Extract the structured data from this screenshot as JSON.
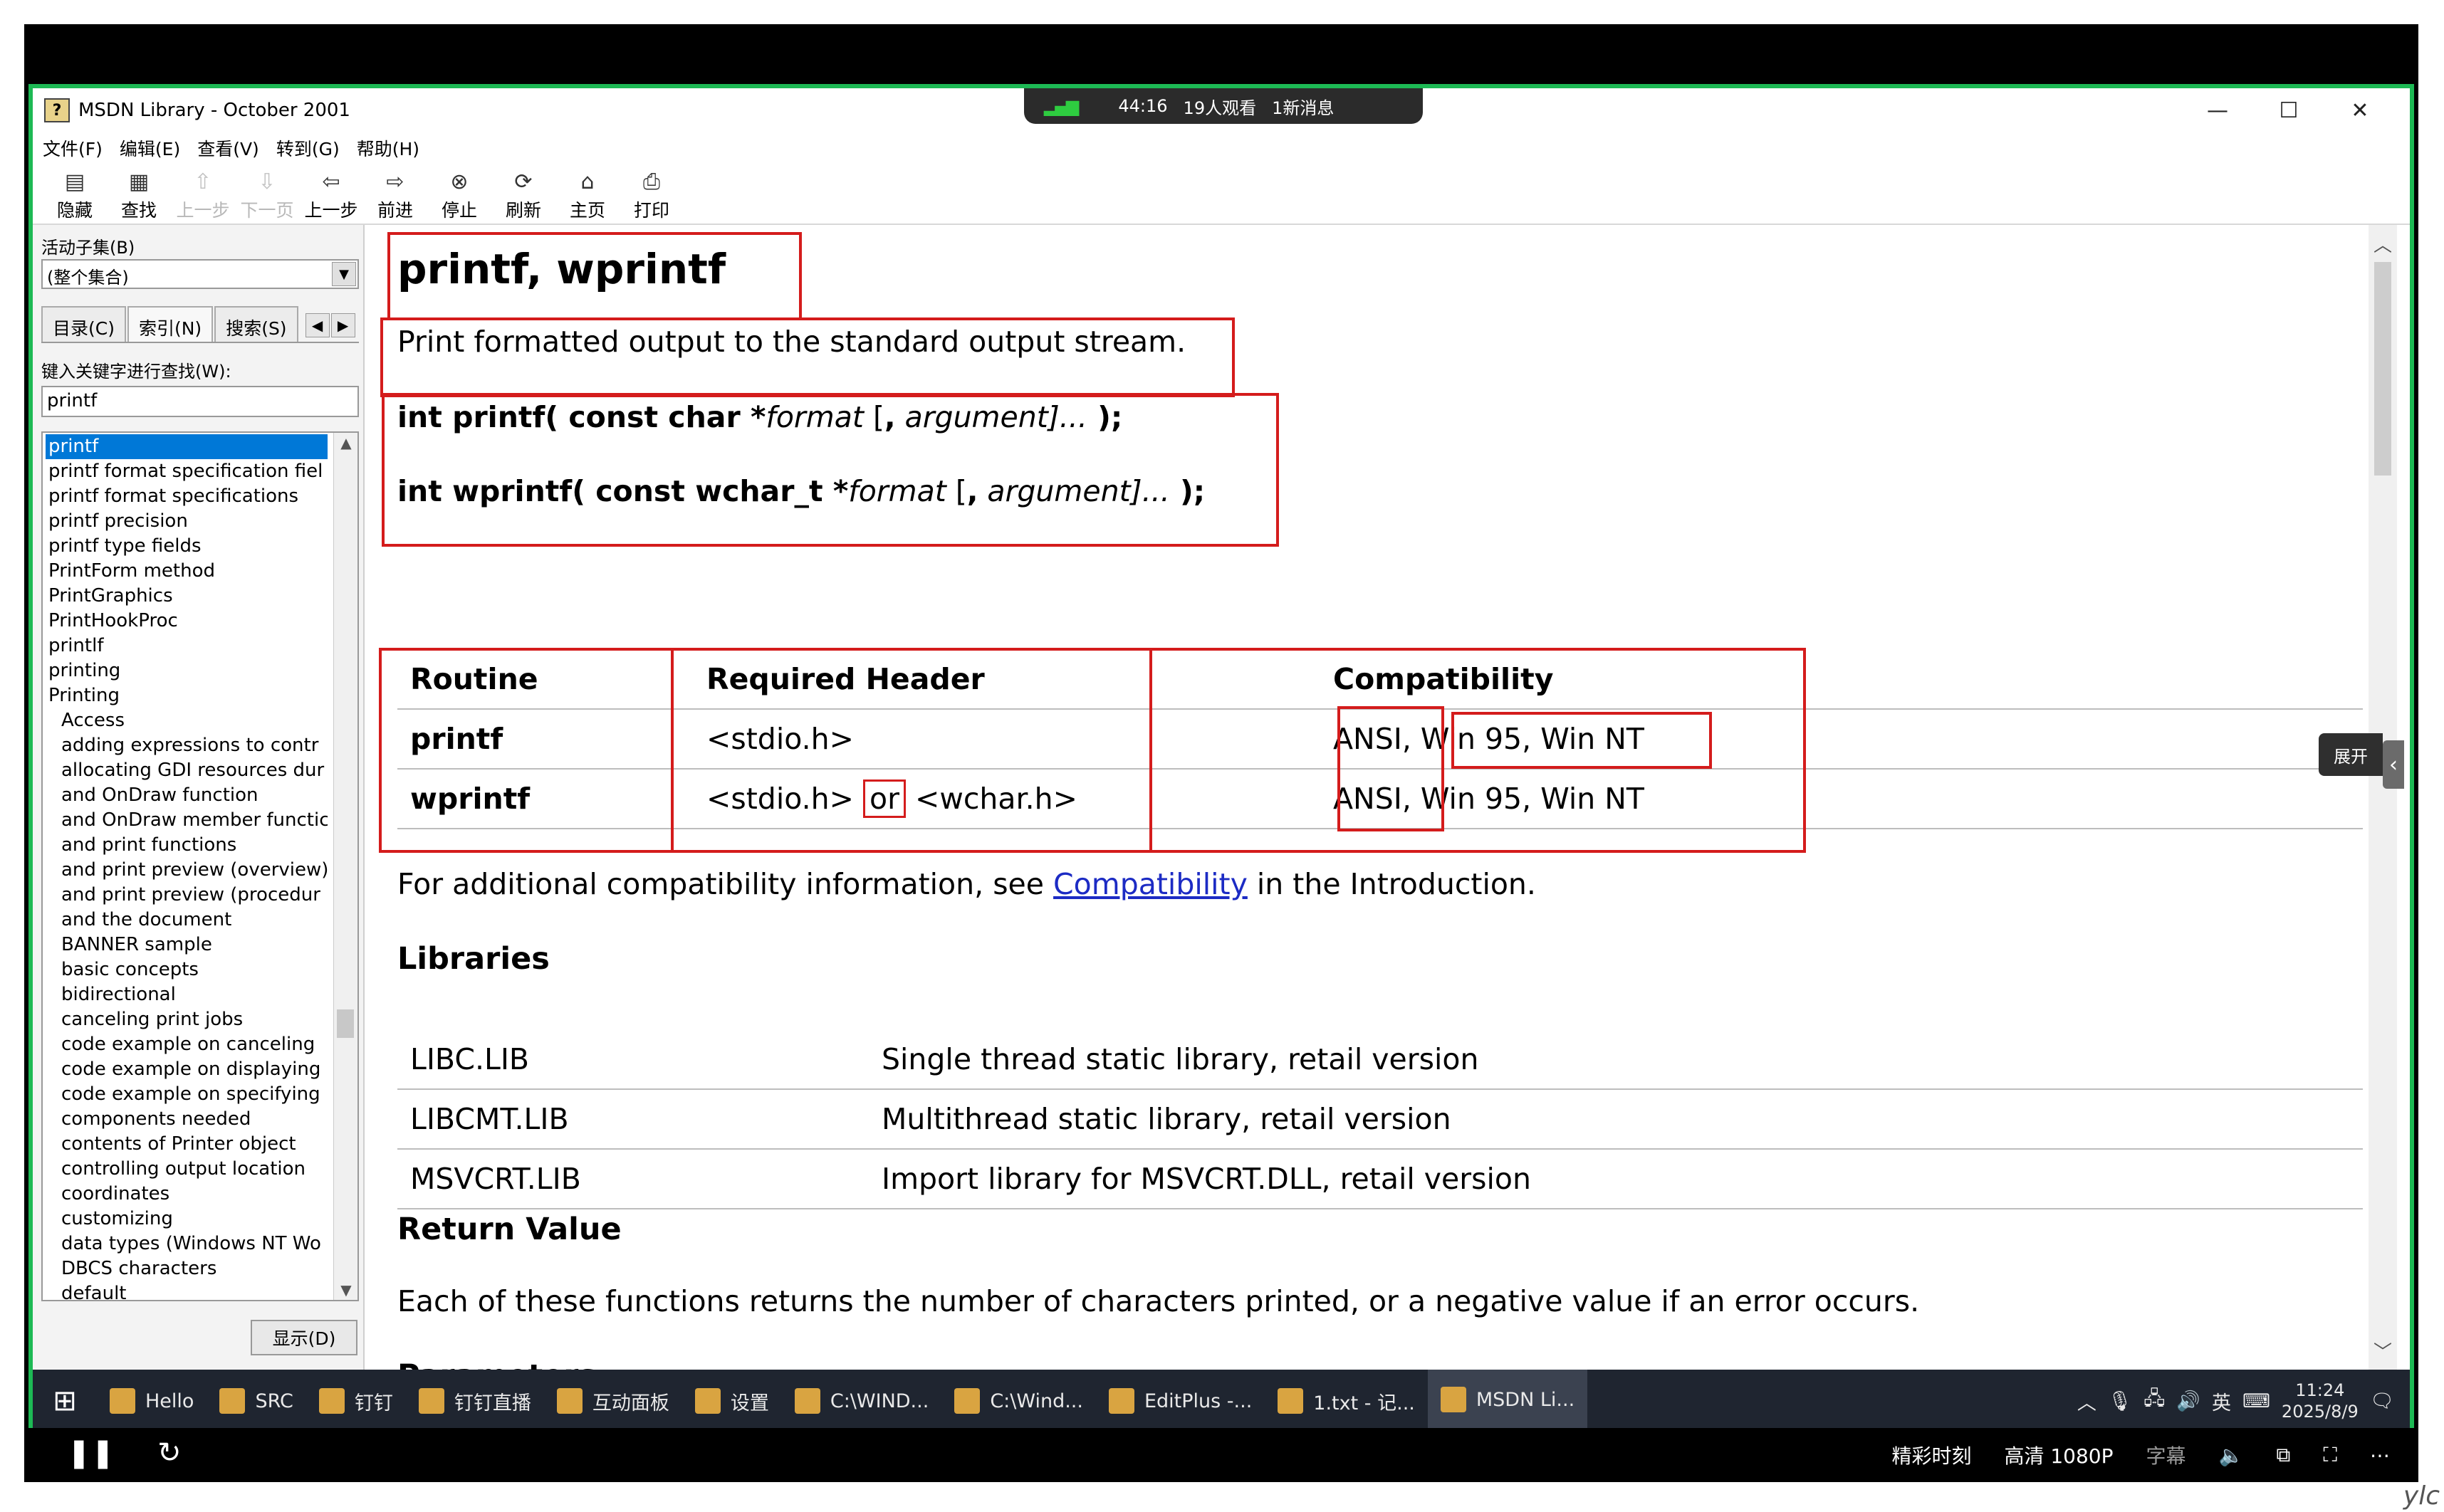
{
  "live": {
    "time": "44:16",
    "viewers": "19人观看",
    "messages": "1新消息"
  },
  "window": {
    "title": "MSDN Library - October 2001"
  },
  "menu": [
    "文件(F)",
    "编辑(E)",
    "查看(V)",
    "转到(G)",
    "帮助(H)"
  ],
  "toolbar": [
    {
      "label": "隐藏",
      "icon": "▤",
      "enabled": true
    },
    {
      "label": "查找",
      "icon": "▦",
      "enabled": true
    },
    {
      "label": "上一步",
      "icon": "⇧",
      "enabled": false
    },
    {
      "label": "下一页",
      "icon": "⇩",
      "enabled": false
    },
    {
      "label": "上一步",
      "icon": "⇦",
      "enabled": true
    },
    {
      "label": "前进",
      "icon": "⇨",
      "enabled": true
    },
    {
      "label": "停止",
      "icon": "⊗",
      "enabled": true
    },
    {
      "label": "刷新",
      "icon": "⟳",
      "enabled": true
    },
    {
      "label": "主页",
      "icon": "⌂",
      "enabled": true
    },
    {
      "label": "打印",
      "icon": "⎙",
      "enabled": true
    }
  ],
  "left": {
    "subset_label": "活动子集(B)",
    "subset_value": "(整个集合)",
    "tabs": [
      "目录(C)",
      "索引(N)",
      "搜索(S)"
    ],
    "keyword_label": "键入关键字进行查找(W):",
    "keyword_value": "printf",
    "index_items": [
      {
        "text": "printf",
        "sel": true
      },
      {
        "text": "printf format specification fiel"
      },
      {
        "text": "printf format specifications"
      },
      {
        "text": "printf precision"
      },
      {
        "text": "printf type fields"
      },
      {
        "text": "PrintForm method"
      },
      {
        "text": "PrintGraphics"
      },
      {
        "text": "PrintHookProc"
      },
      {
        "text": "printlf"
      },
      {
        "text": "printing"
      },
      {
        "text": "Printing"
      },
      {
        "text": "Access",
        "sub": true
      },
      {
        "text": "adding expressions to contr",
        "sub": true
      },
      {
        "text": "allocating GDI resources dur",
        "sub": true
      },
      {
        "text": "and OnDraw function",
        "sub": true
      },
      {
        "text": "and OnDraw member functic",
        "sub": true
      },
      {
        "text": "and print functions",
        "sub": true
      },
      {
        "text": "and print preview (overview)",
        "sub": true
      },
      {
        "text": "and print preview (procedur",
        "sub": true
      },
      {
        "text": "and the document",
        "sub": true
      },
      {
        "text": "BANNER sample",
        "sub": true
      },
      {
        "text": "basic concepts",
        "sub": true
      },
      {
        "text": "bidirectional",
        "sub": true
      },
      {
        "text": "canceling print jobs",
        "sub": true
      },
      {
        "text": "code example on canceling",
        "sub": true
      },
      {
        "text": "code example on displaying",
        "sub": true
      },
      {
        "text": "code example on specifying",
        "sub": true
      },
      {
        "text": "components needed",
        "sub": true
      },
      {
        "text": "contents of Printer object",
        "sub": true
      },
      {
        "text": "controlling output location",
        "sub": true
      },
      {
        "text": "coordinates",
        "sub": true
      },
      {
        "text": "customizing",
        "sub": true
      },
      {
        "text": "data types (Windows NT Wo",
        "sub": true
      },
      {
        "text": "DBCS characters",
        "sub": true
      },
      {
        "text": "default",
        "sub": true
      }
    ],
    "display_button": "显示(D)"
  },
  "doc": {
    "title": "printf, wprintf",
    "summary": "Print formatted output to the standard output stream.",
    "syntax": [
      {
        "lead": "int printf( const char *",
        "arg1": "format",
        "mid": " [",
        "comma": ",",
        "arg2": " argument",
        "tail": "]...",
        "close": " );"
      },
      {
        "lead": "int wprintf( const wchar_t *",
        "arg1": "format",
        "mid": " [",
        "comma": ",",
        "arg2": " argument",
        "tail": "]...",
        "close": " );"
      }
    ],
    "req_table": {
      "headers": [
        "Routine",
        "Required Header",
        "Compatibility"
      ],
      "rows": [
        {
          "routine": "printf",
          "header": "<stdio.h>",
          "header_or": "",
          "header2": "",
          "compat_a": "ANSI",
          "compat_b": ", Win 95, Win NT"
        },
        {
          "routine": "wprintf",
          "header": "<stdio.h>",
          "header_or": "or",
          "header2": "<wchar.h>",
          "compat_a": "ANSI",
          "compat_b": ", Win 95, Win NT"
        }
      ]
    },
    "compat_note": {
      "before": "For additional compatibility information, see ",
      "link": "Compatibility",
      "after": " in the Introduction."
    },
    "libraries_heading": "Libraries",
    "libraries": [
      {
        "lib": "LIBC.LIB",
        "desc": "Single thread static library, retail version"
      },
      {
        "lib": "LIBCMT.LIB",
        "desc": "Multithread static library, retail version"
      },
      {
        "lib": "MSVCRT.LIB",
        "desc": "Import library for MSVCRT.DLL, retail version"
      }
    ],
    "return_heading": "Return Value",
    "return_text": "Each of these functions returns the number of characters printed, or a negative value if an error occurs.",
    "params_heading": "Parameters"
  },
  "expand_label": "展开",
  "taskbar": {
    "items": [
      {
        "label": "Hello"
      },
      {
        "label": "SRC"
      },
      {
        "label": "钉钉"
      },
      {
        "label": "钉钉直播"
      },
      {
        "label": "互动面板"
      },
      {
        "label": "设置"
      },
      {
        "label": "C:\\WIND..."
      },
      {
        "label": "C:\\Wind..."
      },
      {
        "label": "EditPlus -..."
      },
      {
        "label": "1.txt - 记..."
      },
      {
        "label": "MSDN Li...",
        "active": true
      }
    ],
    "ime": "英",
    "time": "11:24",
    "date": "2025/8/9"
  },
  "player": {
    "quality_a": "精彩时刻",
    "quality_b": "高清 1080P",
    "subtitle": "字幕"
  },
  "corner": "ylc"
}
